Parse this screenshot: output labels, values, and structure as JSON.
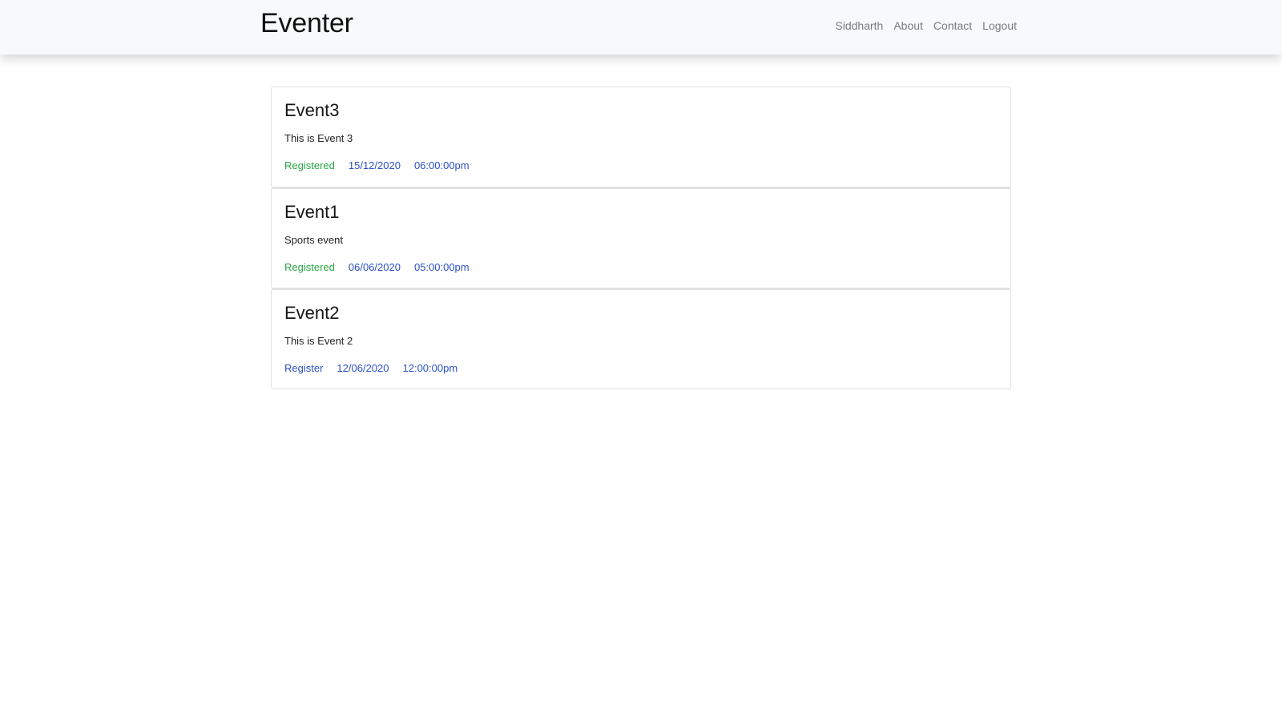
{
  "navbar": {
    "brand": "Eventer",
    "links": [
      "Siddharth",
      "About",
      "Contact",
      "Logout"
    ]
  },
  "events": [
    {
      "title": "Event3",
      "description": "This is Event 3",
      "status": "Registered",
      "date": "15/12/2020",
      "time": "06:00:00pm"
    },
    {
      "title": "Event1",
      "description": "Sports event",
      "status": "Registered",
      "date": "06/06/2020",
      "time": "05:00:00pm"
    },
    {
      "title": "Event2",
      "description": "This is Event 2",
      "status": "Register",
      "date": "12/06/2020",
      "time": "12:00:00pm"
    }
  ],
  "colors": {
    "registered": "#28a745",
    "link_blue": "#2b50c8",
    "navbar_bg": "#f8f9fa"
  }
}
